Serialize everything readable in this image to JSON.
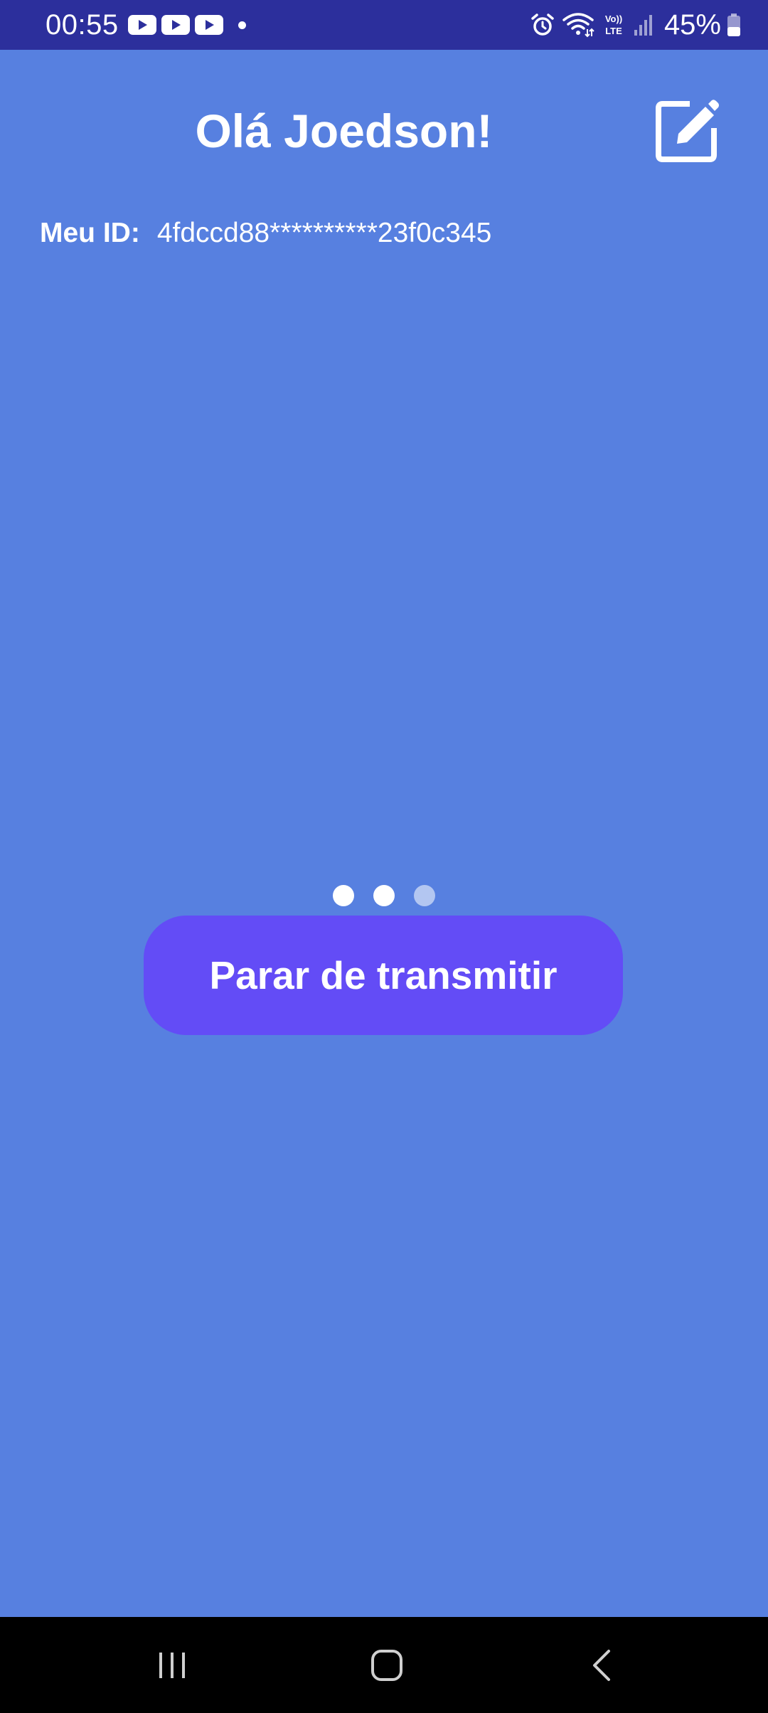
{
  "status_bar": {
    "time": "00:55",
    "notification_icons": [
      "youtube-icon",
      "youtube-icon",
      "youtube-icon",
      "notification-dot"
    ],
    "system_icons": [
      "alarm-icon",
      "wifi-icon",
      "volte-icon",
      "signal-icon",
      "battery-icon"
    ],
    "volte_label_top": "Vo))",
    "volte_label_bottom": "LTE",
    "battery_percent": "45%",
    "battery_level": 0.45,
    "background_color": "#2C2F9C"
  },
  "header": {
    "greeting": "Olá Joedson!",
    "edit_icon": "edit-icon"
  },
  "id_row": {
    "label": "Meu ID:",
    "value": "4fdccd88**********23f0c345"
  },
  "loading_indicator": {
    "dots": 3,
    "active_dots": 2
  },
  "action": {
    "stop_label": "Parar de transmitir",
    "button_color": "#634CF6"
  },
  "nav_bar": {
    "buttons": [
      "recents-icon",
      "home-icon",
      "back-icon"
    ]
  },
  "colors": {
    "background": "#5780E0",
    "text": "#FFFFFF"
  }
}
